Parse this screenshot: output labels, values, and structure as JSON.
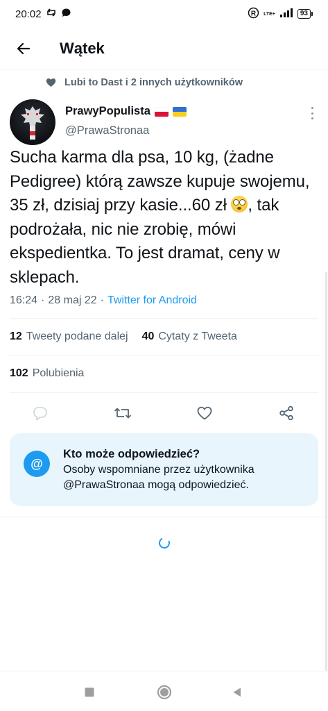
{
  "status_bar": {
    "time": "20:02",
    "network": "LTE+",
    "battery": "93",
    "icons": [
      "sync-icon",
      "chat-bubble-icon",
      "registered-icon",
      "signal-icon",
      "battery-icon"
    ]
  },
  "header": {
    "back_icon": "arrow-left-icon",
    "title": "Wątek"
  },
  "social_context": {
    "icon": "heart-icon",
    "text": "Lubi to Dast i 2 innych użytkowników"
  },
  "author": {
    "name": "PrawyPopulista",
    "handle": "@PrawaStronaa",
    "flags": [
      "poland-flag-icon",
      "ukraine-flag-icon"
    ],
    "more_icon": "more-vertical-icon"
  },
  "tweet": {
    "text_part1": "Sucha karma dla psa, 10 kg, (żadne Pedigree) którą zawsze kupuje swojemu, 35 zł, dzisiaj przy kasie...60 zł ",
    "emoji": "flushed-face-icon",
    "text_part2": ", tak podrożała, nic nie zrobię, mówi ekspedientka. To jest dramat, ceny w sklepach.",
    "time": "16:24",
    "separator": "·",
    "date": "28 maj 22",
    "source_separator": "·",
    "source": "Twitter for Android"
  },
  "stats": {
    "retweets_count": "12",
    "retweets_label": "Tweety podane dalej",
    "quotes_count": "40",
    "quotes_label": "Cytaty z Tweeta",
    "likes_count": "102",
    "likes_label": "Polubienia"
  },
  "actions": [
    "reply-icon",
    "retweet-icon",
    "like-icon",
    "share-icon"
  ],
  "reply_card": {
    "icon_text": "@",
    "title": "Kto może odpowiedzieć?",
    "body": "Osoby wspomniane przez użytkownika @PrawaStronaa mogą odpowiedzieć."
  },
  "nav_bar": [
    "recents-square-icon",
    "home-circle-icon",
    "back-triangle-icon"
  ],
  "colors": {
    "accent": "#1d9bf0",
    "text_primary": "#0f1419",
    "text_secondary": "#536471",
    "card_bg": "#e8f5fd",
    "divider": "#eff3f4"
  }
}
